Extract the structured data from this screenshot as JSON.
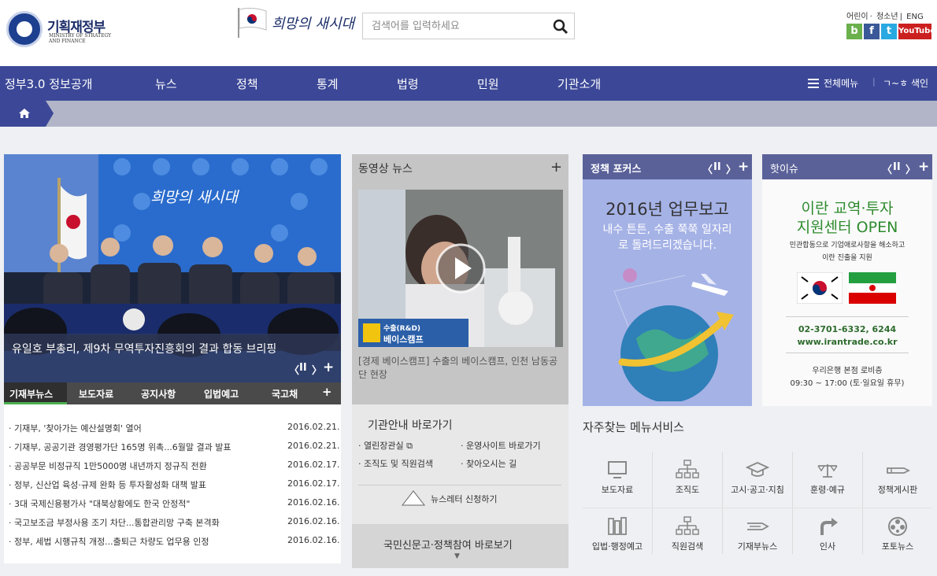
{
  "header": {
    "logo_title": "기획재정부",
    "logo_en_1": "MINISTRY OF STRATEGY",
    "logo_en_2": "AND FINANCE",
    "slogan": "희망의 새시대",
    "search_placeholder": "검색어를 입력하세요",
    "util_links": [
      "어린이",
      "청소년",
      "ENG"
    ],
    "sns": [
      {
        "label": "b",
        "color": "#6ab04c"
      },
      {
        "label": "f",
        "color": "#3b5998"
      },
      {
        "label": "t",
        "color": "#29a9e1"
      },
      {
        "label": "YouTube",
        "color": "#cc2020"
      }
    ]
  },
  "nav": {
    "items": [
      "정부3.0 정보공개",
      "뉴스",
      "정책",
      "통계",
      "법령",
      "민원",
      "기관소개"
    ],
    "all_menu": "전체메뉴",
    "index": "ㄱ~ㅎ 색인"
  },
  "main_news": {
    "slogan_banner": "희망의 새시대",
    "caption": "유일호 부총리, 제9차 무역투자진흥회의 결과 합동 브리핑",
    "tabs": [
      "기재부뉴스",
      "보도자료",
      "공지사항",
      "입법예고",
      "국고채"
    ],
    "items": [
      {
        "title": "기재부, '찾아가는 예산설명회' 열어",
        "date": "2016.02.21."
      },
      {
        "title": "기재부, 공공기관 경영평가단 165명 위촉...6월말 결과 발표",
        "date": "2016.02.21."
      },
      {
        "title": "공공부문 비정규직 1만5000명 내년까지 정규직 전환",
        "date": "2016.02.17."
      },
      {
        "title": "정부, 신산업 육성·규제 완화 등 투자활성화 대책 발표",
        "date": "2016.02.17."
      },
      {
        "title": "3대 국제신용평가사 \"대북상황에도 한국 안정적\"",
        "date": "2016.02.16."
      },
      {
        "title": "국고보조금 부정사용 조기 차단...통합관리망 구축 본격화",
        "date": "2016.02.16."
      },
      {
        "title": "정부, 세법 시행규칙 개정...출퇴근 차량도 업무용 인정",
        "date": "2016.02.16."
      }
    ]
  },
  "video": {
    "title": "동영상 뉴스",
    "badge_small": "수출(R&D)",
    "badge_big": "베이스캠프",
    "description": "[경제 베이스캠프] 수출의 베이스캠프, 인천 남동공단 현장"
  },
  "quick": {
    "title": "기관안내 바로가기",
    "links": [
      "열린장관실",
      "운영사이트 바로가기",
      "조직도 및 직원검색",
      "찾아오시는 길"
    ],
    "newsletter": "뉴스레터 신청하기",
    "people": "국민신문고·정책참여 바로보기"
  },
  "focus": {
    "title": "정책 포커스",
    "headline": "2016년 업무보고",
    "sub": "내수 튼튼, 수출 쭉쭉 일자리로 돌려드리겠습니다.",
    "colors": {
      "head": "#5a6199",
      "body": "#a5b2e6"
    }
  },
  "hot_issue": {
    "title": "핫이슈",
    "headline_1": "이란 교역·투자",
    "headline_2": "지원센터 OPEN",
    "sub_1": "민관합동으로 기업애로사항을 해소하고",
    "sub_2": "이란 진출을 지원",
    "phone": "02-3701-6332, 6244",
    "url": "www.irantrade.co.kr",
    "addr_1": "우리은행 본점 로비층",
    "addr_2": "09:30 ~ 17:00 (토·일요일 휴무)"
  },
  "freq": {
    "title": "자주찾는 메뉴서비스",
    "items": [
      "보도자료",
      "조직도",
      "고시·공고·지침",
      "훈령·예규",
      "정책게시판",
      "입법·행정예고",
      "직원검색",
      "기재부뉴스",
      "인사",
      "포토뉴스"
    ]
  },
  "controls": {
    "prev": "〈",
    "pause": "II",
    "next": "〉",
    "plus": "+"
  }
}
